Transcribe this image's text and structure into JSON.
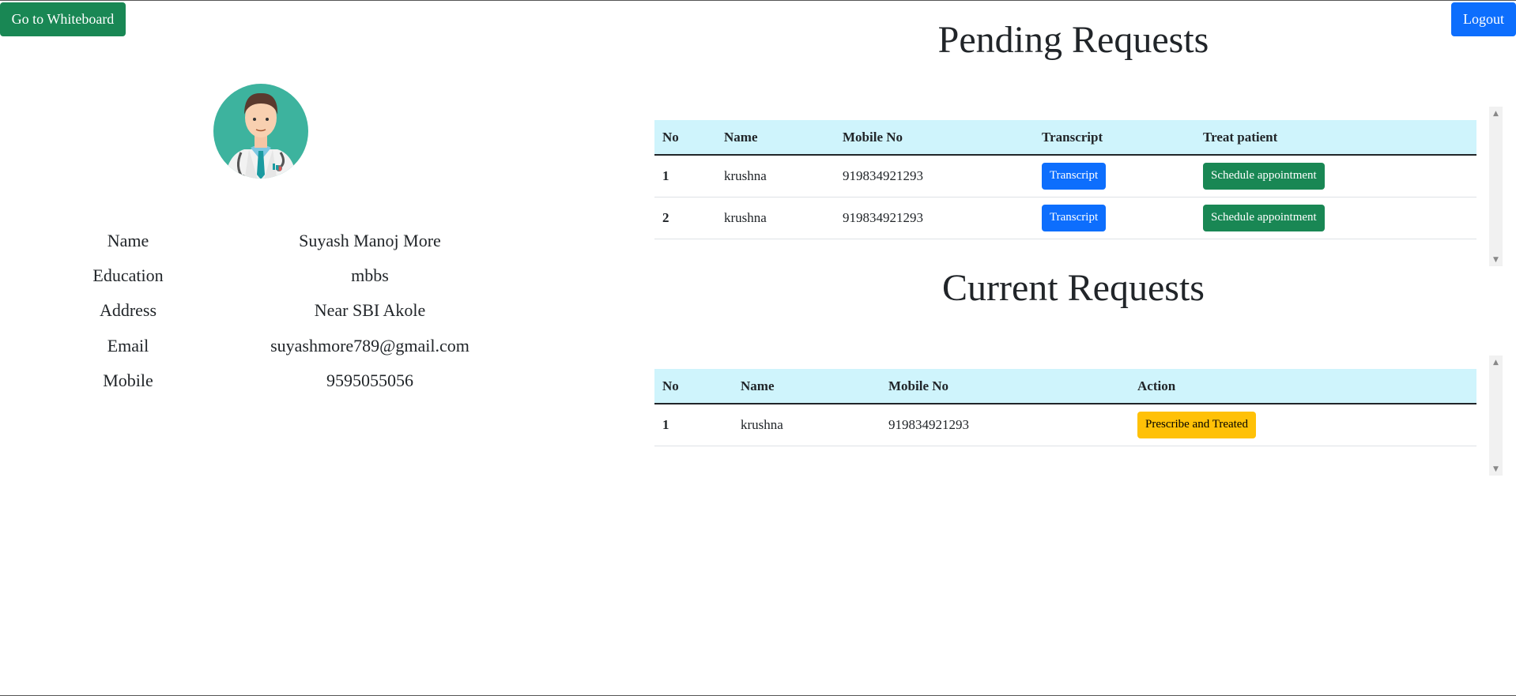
{
  "header": {
    "whiteboard_label": "Go to Whiteboard",
    "logout_label": "Logout"
  },
  "profile": {
    "avatar_icon": "doctor-avatar-icon",
    "rows": [
      {
        "label": "Name",
        "value": "Suyash Manoj More"
      },
      {
        "label": "Education",
        "value": "mbbs"
      },
      {
        "label": "Address",
        "value": "Near SBI Akole"
      },
      {
        "label": "Email",
        "value": "suyashmore789@gmail.com"
      },
      {
        "label": "Mobile",
        "value": "9595055056"
      }
    ]
  },
  "pending": {
    "title": "Pending Requests",
    "columns": [
      "No",
      "Name",
      "Mobile No",
      "Transcript",
      "Treat patient"
    ],
    "rows": [
      {
        "no": "1",
        "name": "krushna",
        "mobile": "919834921293",
        "transcript_label": "Transcript",
        "treat_label": "Schedule appointment"
      },
      {
        "no": "2",
        "name": "krushna",
        "mobile": "919834921293",
        "transcript_label": "Transcript",
        "treat_label": "Schedule appointment"
      }
    ]
  },
  "current": {
    "title": "Current Requests",
    "columns": [
      "No",
      "Name",
      "Mobile No",
      "Action"
    ],
    "rows": [
      {
        "no": "1",
        "name": "krushna",
        "mobile": "919834921293",
        "action_label": "Prescribe and Treated"
      }
    ]
  },
  "colors": {
    "primary": "#0d6efd",
    "success": "#198754",
    "warning": "#ffc107",
    "table_header": "#cff4fc",
    "avatar_bg": "#3db39e"
  }
}
